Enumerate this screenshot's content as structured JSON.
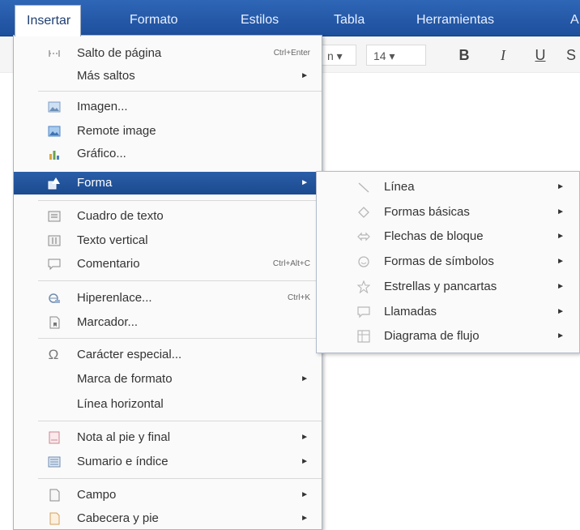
{
  "menubar": {
    "items": [
      "Insertar",
      "Formato",
      "Estilos",
      "Tabla",
      "Herramientas",
      "A"
    ]
  },
  "toolbar": {
    "font_partial": "n ▾",
    "font_size": "14 ▾",
    "bold": "B",
    "italic": "I",
    "underline": "U",
    "strike_partial": "S"
  },
  "insert_menu": {
    "items": [
      {
        "label": "Salto de página",
        "shortcut": "Ctrl+Enter",
        "icon": "page-break-icon"
      },
      {
        "label": "Más saltos",
        "arrow": "►"
      },
      {
        "label": "Imagen...",
        "icon": "image-icon"
      },
      {
        "label": "Remote image",
        "icon": "remote-image-icon"
      },
      {
        "label": "Gráfico...",
        "icon": "chart-icon"
      },
      {
        "label": "Forma",
        "arrow": "►",
        "icon": "shape-icon"
      },
      {
        "label": "Cuadro de texto",
        "icon": "text-box-icon"
      },
      {
        "label": "Texto vertical",
        "icon": "vertical-text-icon"
      },
      {
        "label": "Comentario",
        "shortcut": "Ctrl+Alt+C",
        "icon": "comment-icon"
      },
      {
        "label": "Hiperenlace...",
        "shortcut": "Ctrl+K",
        "icon": "hyperlink-icon"
      },
      {
        "label": "Marcador...",
        "icon": "bookmark-icon"
      },
      {
        "label": "Carácter especial...",
        "icon": "omega-icon"
      },
      {
        "label": "Marca de formato",
        "arrow": "►"
      },
      {
        "label": "Línea horizontal"
      },
      {
        "label": "Nota al pie y final",
        "arrow": "►",
        "icon": "footnote-icon"
      },
      {
        "label": "Sumario e índice",
        "arrow": "►",
        "icon": "toc-icon"
      },
      {
        "label": "Campo",
        "arrow": "►",
        "icon": "field-icon"
      },
      {
        "label": "Cabecera y pie",
        "arrow": "►",
        "icon": "header-footer-icon"
      }
    ]
  },
  "shape_submenu": {
    "items": [
      {
        "label": "Línea",
        "arrow": "►",
        "icon": "line-icon"
      },
      {
        "label": "Formas básicas",
        "arrow": "►",
        "icon": "basic-shapes-icon"
      },
      {
        "label": "Flechas de bloque",
        "arrow": "►",
        "icon": "block-arrow-icon"
      },
      {
        "label": "Formas de símbolos",
        "arrow": "►",
        "icon": "symbol-shapes-icon"
      },
      {
        "label": "Estrellas y pancartas",
        "arrow": "►",
        "icon": "star-icon"
      },
      {
        "label": "Llamadas",
        "arrow": "►",
        "icon": "callout-icon"
      },
      {
        "label": "Diagrama de flujo",
        "arrow": "►",
        "icon": "flowchart-icon"
      }
    ]
  },
  "colors": {
    "menubar": "#1d4f9c",
    "highlight": "#1b4a8f"
  }
}
